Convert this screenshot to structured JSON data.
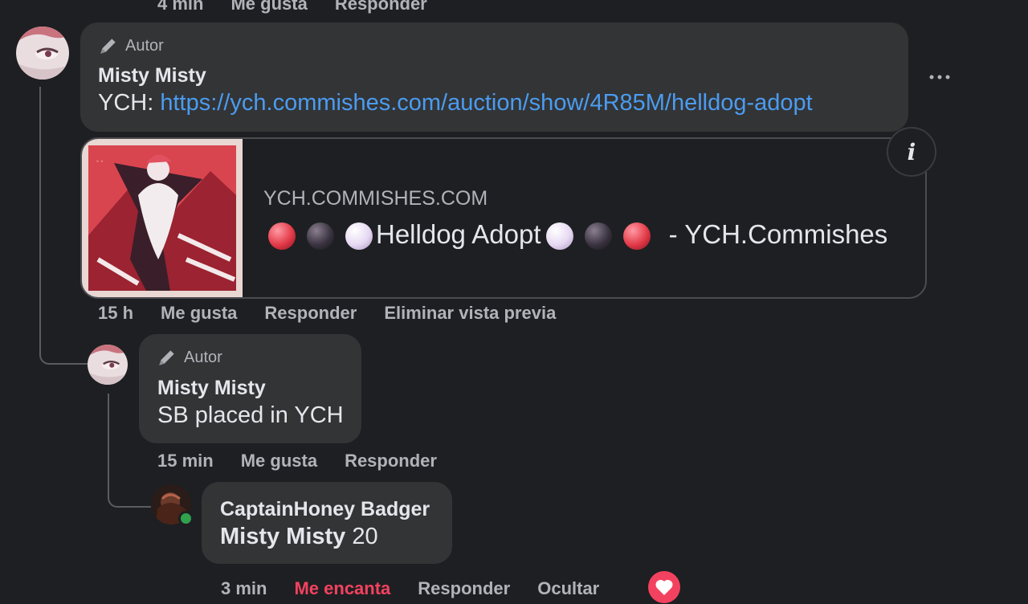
{
  "top_actions": {
    "time": "4 min",
    "like": "Me gusta",
    "reply": "Responder"
  },
  "comment1": {
    "badge": "Autor",
    "author": "Misty Misty",
    "prefix": "YCH: ",
    "link": "https://ych.commishes.com/auction/show/4R85M/helldog-adopt",
    "more_icon": "ellipsis-icon",
    "preview": {
      "domain": "YCH.COMMISHES.COM",
      "title_main": "Helldog Adopt",
      "title_suffix": " - YCH.Commishes",
      "info_icon": "info-icon",
      "orb_colors": [
        "#e23a48",
        "#3a3340",
        "#e6d8f2"
      ]
    },
    "actions": {
      "time": "15 h",
      "like": "Me gusta",
      "reply": "Responder",
      "remove_preview": "Eliminar vista previa"
    }
  },
  "comment2": {
    "badge": "Autor",
    "author": "Misty Misty",
    "text": "SB placed in YCH",
    "actions": {
      "time": "15 min",
      "like": "Me gusta",
      "reply": "Responder"
    }
  },
  "comment3": {
    "author": "CaptainHoney Badger",
    "mention": "Misty Misty",
    "text": " 20",
    "actions": {
      "time": "3 min",
      "love": "Me encanta",
      "reply": "Responder",
      "hide": "Ocultar"
    },
    "reaction_icon": "heart-icon",
    "accent_red": "#f3425f",
    "online_color": "#31a24c"
  }
}
